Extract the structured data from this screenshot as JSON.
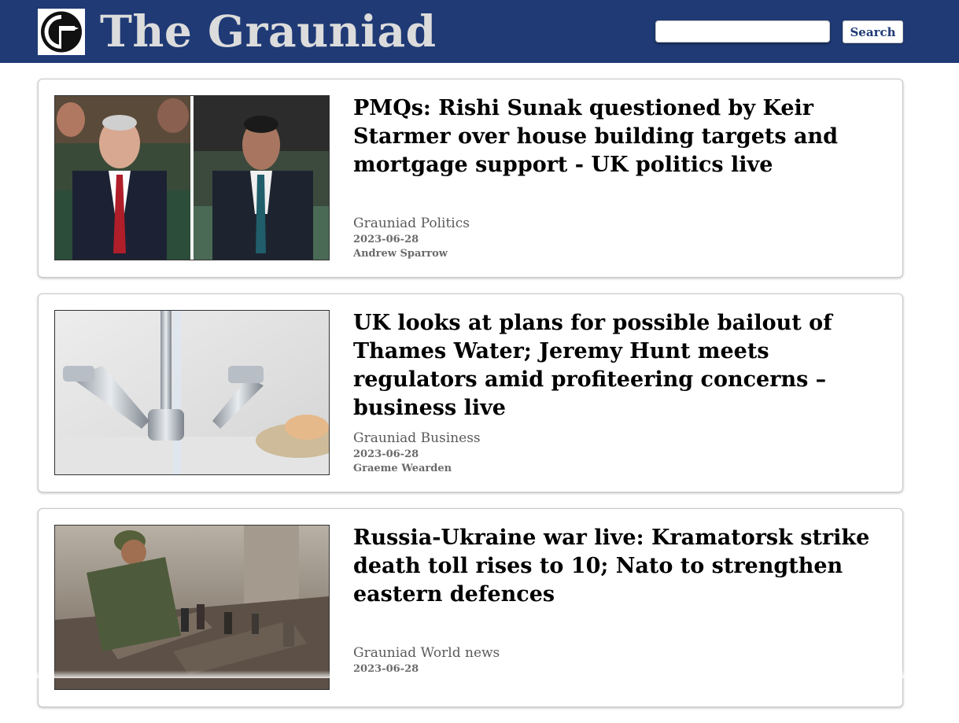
{
  "header": {
    "site_title": "The Grauniad",
    "logo_icon": "grauniad-logo-icon",
    "search": {
      "value": "",
      "placeholder": "",
      "button_label": "Search"
    },
    "colors": {
      "header_background": "#1f3a75",
      "title_text": "#dcdcdc"
    }
  },
  "articles": [
    {
      "title": "PMQs: Rishi Sunak questioned by Keir Starmer over house building targets and mortgage support - UK politics live",
      "section": "Grauniad Politics",
      "date": "2023-06-28",
      "author": "Andrew Sparrow",
      "image": "pmqs-photo"
    },
    {
      "title": "UK looks at plans for possible bailout of Thames Water; Jeremy Hunt meets regulators amid profiteering concerns – business live",
      "section": "Grauniad Business",
      "date": "2023-06-28",
      "author": "Graeme Wearden",
      "image": "tap-water-photo"
    },
    {
      "title": "Russia-Ukraine war live: Kramatorsk strike death toll rises to 10; Nato to strengthen eastern defences",
      "section": "Grauniad World news",
      "date": "2023-06-28",
      "author": "",
      "image": "rubble-rescue-photo"
    }
  ]
}
